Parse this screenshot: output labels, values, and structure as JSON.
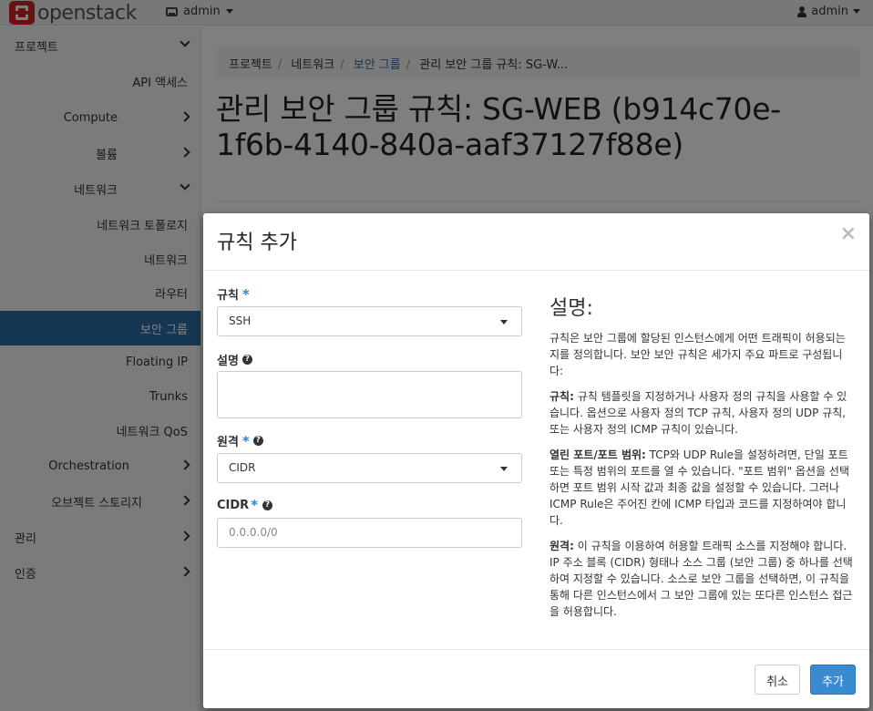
{
  "topbar": {
    "logo_text": "openstack",
    "project_label": "admin",
    "user_label": "admin"
  },
  "sidebar": {
    "project": "프로젝트",
    "api_access": "API 액세스",
    "compute": "Compute",
    "volume": "볼륨",
    "network": "네트워크",
    "network_topology": "네트워크 토폴로지",
    "networks": "네트워크",
    "routers": "라우터",
    "security_groups": "보안 그룹",
    "floating_ip": "Floating IP",
    "trunks": "Trunks",
    "network_qos": "네트워크 QoS",
    "orchestration": "Orchestration",
    "object_storage": "오브젝트 스토리지",
    "admin": "관리",
    "identity": "인증"
  },
  "breadcrumb": {
    "items": [
      "프로젝트",
      "네트워크",
      "보안 그룹",
      "관리 보안 그룹 규칙: SG-W..."
    ]
  },
  "page": {
    "title": "관리 보안 그룹 규칙: SG-WEB (b914c70e-1f6b-4140-840a-aaf37127f88e)"
  },
  "modal": {
    "title": "규칙 추가",
    "close": "×",
    "rule_label": "규칙",
    "rule_value": "SSH",
    "desc_label": "설명",
    "remote_label": "원격",
    "remote_value": "CIDR",
    "cidr_label": "CIDR",
    "cidr_placeholder": "0.0.0.0/0",
    "required_mark": "*",
    "help_mark": "?",
    "help": {
      "heading": "설명:",
      "intro": "규칙은 보안 그룹에 할당된 인스턴스에게 어떤 트래픽이 허용되는지를 정의합니다. 보안 보안 규칙은 세가지 주요 파트로 구성됩니다:",
      "rule_term": "규칙:",
      "rule_text": " 규칙 템플릿을 지정하거나 사용자 정의 규칙을 사용할 수 있습니다. 옵션으로 사용자 정의 TCP 규칙, 사용자 정의 UDP 규칙, 또는 사용자 정의 ICMP 규칙이 있습니다.",
      "port_term": "열린 포트/포트 범위:",
      "port_text": " TCP와 UDP Rule을 설정하려면, 단일 포트 또는 특정 범위의 포트를 열 수 있습니다. \"포트 범위\" 옵션을 선택하면 포트 범위 시작 값과 최종 값을 설정할 수 있습니다. 그러나 ICMP Rule은 주어진 칸에 ICMP 타입과 코드를 지정하여야 합니다.",
      "remote_term": "원격:",
      "remote_text": " 이 규칙을 이용하여 허용할 트래픽 소스를 지정해야 합니다. IP 주소 블록 (CIDR) 형태나 소스 그룹 (보안 그룹) 중 하나를 선택하여 지정할 수 있습니다. 소스로 보안 그룹을 선택하면, 이 규칙을 통해 다른 인스턴스에서 그 보안 그룹에 있는 또다른 인스턴스 접근을 허용합니다."
    },
    "cancel_label": "취소",
    "add_label": "추가"
  },
  "colors": {
    "accent": "#2e6da4",
    "primary_button": "#3a8ad1",
    "brand_red": "#d42027"
  }
}
